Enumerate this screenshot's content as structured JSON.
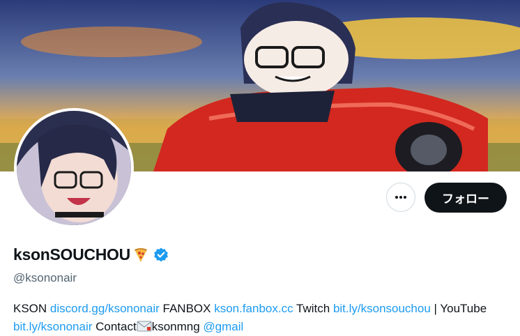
{
  "profile": {
    "display_name": "ksonSOUCHOU",
    "name_emoji": "pizza-emoji",
    "verified": true,
    "handle": "@ksononair"
  },
  "actions": {
    "more_icon": "more-horizontal-icon",
    "follow_label": "フォロー"
  },
  "bio": {
    "t1": "KSON ",
    "link1": "discord.gg/ksononair",
    "t2": " FANBOX ",
    "link2": "kson.fanbox.cc",
    "t3": " Twitch ",
    "link3": "bit.ly/ksonsouchou",
    "t4": " | YouTube ",
    "link4": "bit.ly/ksononair",
    "t5": " Contact",
    "mail_icon": "envelope-icon",
    "t6": "ksonmng ",
    "link5": "@gmail"
  },
  "colors": {
    "link": "#1d9bf0",
    "verified": "#1d9bf0",
    "follow_bg": "#0f1419",
    "handle": "#536471"
  }
}
